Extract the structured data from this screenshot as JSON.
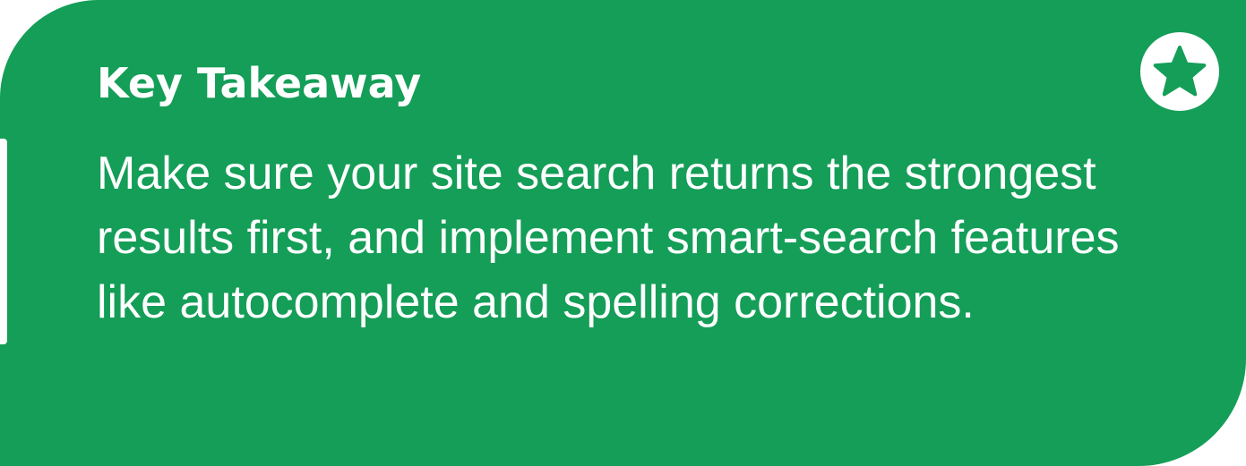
{
  "callout": {
    "title": "Key Takeaway",
    "body": "Make sure your site search returns the strongest results first, and implement smart-search features like autocomplete and spelling corrections.",
    "icon": "star-icon",
    "colors": {
      "background": "#149e57",
      "text": "#ffffff"
    }
  }
}
